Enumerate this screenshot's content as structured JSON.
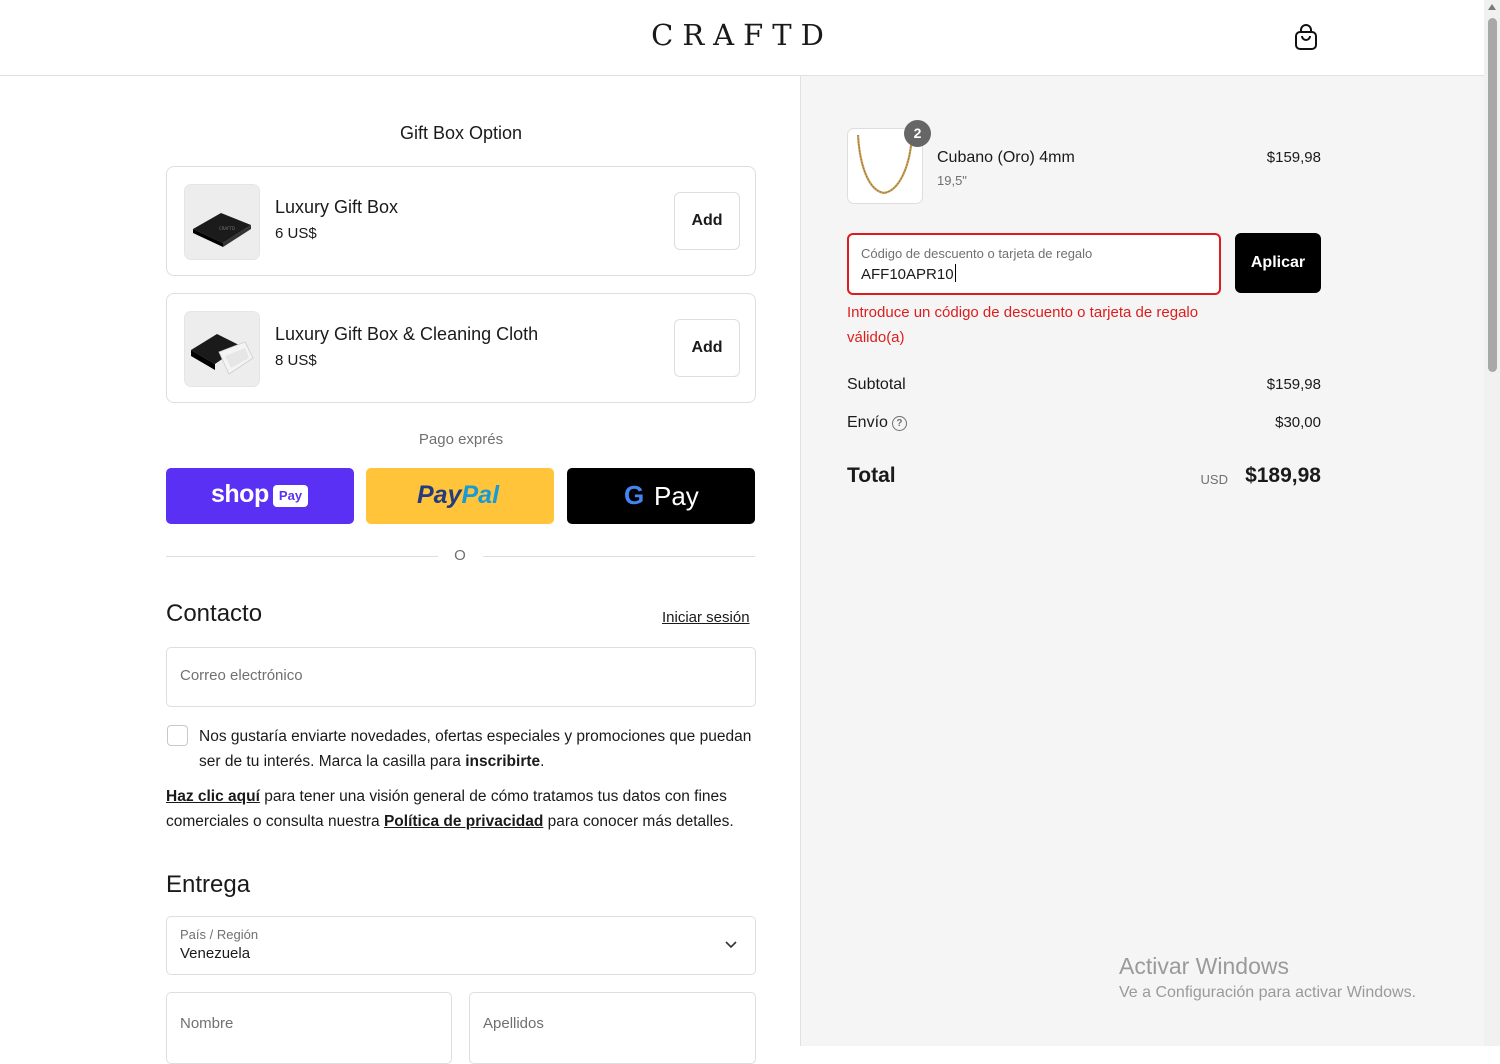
{
  "header": {
    "logo_text": "CRAFTD",
    "cart_icon": "shopping-bag-icon"
  },
  "gift": {
    "title": "Gift Box Option",
    "options": [
      {
        "name": "Luxury Gift Box",
        "price": "6 US$",
        "button": "Add"
      },
      {
        "name": "Luxury Gift Box & Cleaning Cloth",
        "price": "8 US$",
        "button": "Add"
      }
    ]
  },
  "express": {
    "label": "Pago exprés",
    "shop_pay": {
      "shop": "shop",
      "pay": "Pay"
    },
    "paypal": {
      "pay": "Pay",
      "pal": "Pal"
    },
    "gpay": {
      "g": "G",
      "pay": "Pay"
    },
    "separator": "O"
  },
  "contact": {
    "title": "Contacto",
    "login_link": "Iniciar sesión",
    "email_placeholder": "Correo electrónico",
    "newsletter_text": "Nos gustaría enviarte novedades, ofertas especiales y promociones que puedan ser de tu interés. Marca la casilla para ",
    "newsletter_bold": "inscribirte",
    "newsletter_end": ".",
    "privacy_link1": "Haz clic aquí",
    "privacy_text1": " para tener una visión general de cómo tratamos tus datos con fines comerciales o consulta nuestra ",
    "privacy_link2": "Política de privacidad",
    "privacy_text2": " para conocer más detalles."
  },
  "delivery": {
    "title": "Entrega",
    "country_label": "País / Región",
    "country_value": "Venezuela",
    "first_name_placeholder": "Nombre",
    "last_name_placeholder": "Apellidos"
  },
  "summary": {
    "product": {
      "name": "Cubano (Oro) 4mm",
      "variant": "19,5\"",
      "price": "$159,98",
      "quantity": "2"
    },
    "discount": {
      "label": "Código de descuento o tarjeta de regalo",
      "value": "AFF10APR10",
      "apply_button": "Aplicar",
      "error": "Introduce un código de descuento o tarjeta de regalo válido(a)"
    },
    "subtotal_label": "Subtotal",
    "subtotal_value": "$159,98",
    "shipping_label": "Envío",
    "shipping_value": "$30,00",
    "total_label": "Total",
    "total_currency": "USD",
    "total_value": "$189,98"
  },
  "watermark": {
    "title": "Activar Windows",
    "subtitle": "Ve a Configuración para activar Windows."
  },
  "colors": {
    "shop_pay": "#5a31f4",
    "paypal": "#ffc439",
    "gpay": "#000000",
    "error": "#dd1d1d",
    "summary_bg": "#f5f5f5"
  }
}
